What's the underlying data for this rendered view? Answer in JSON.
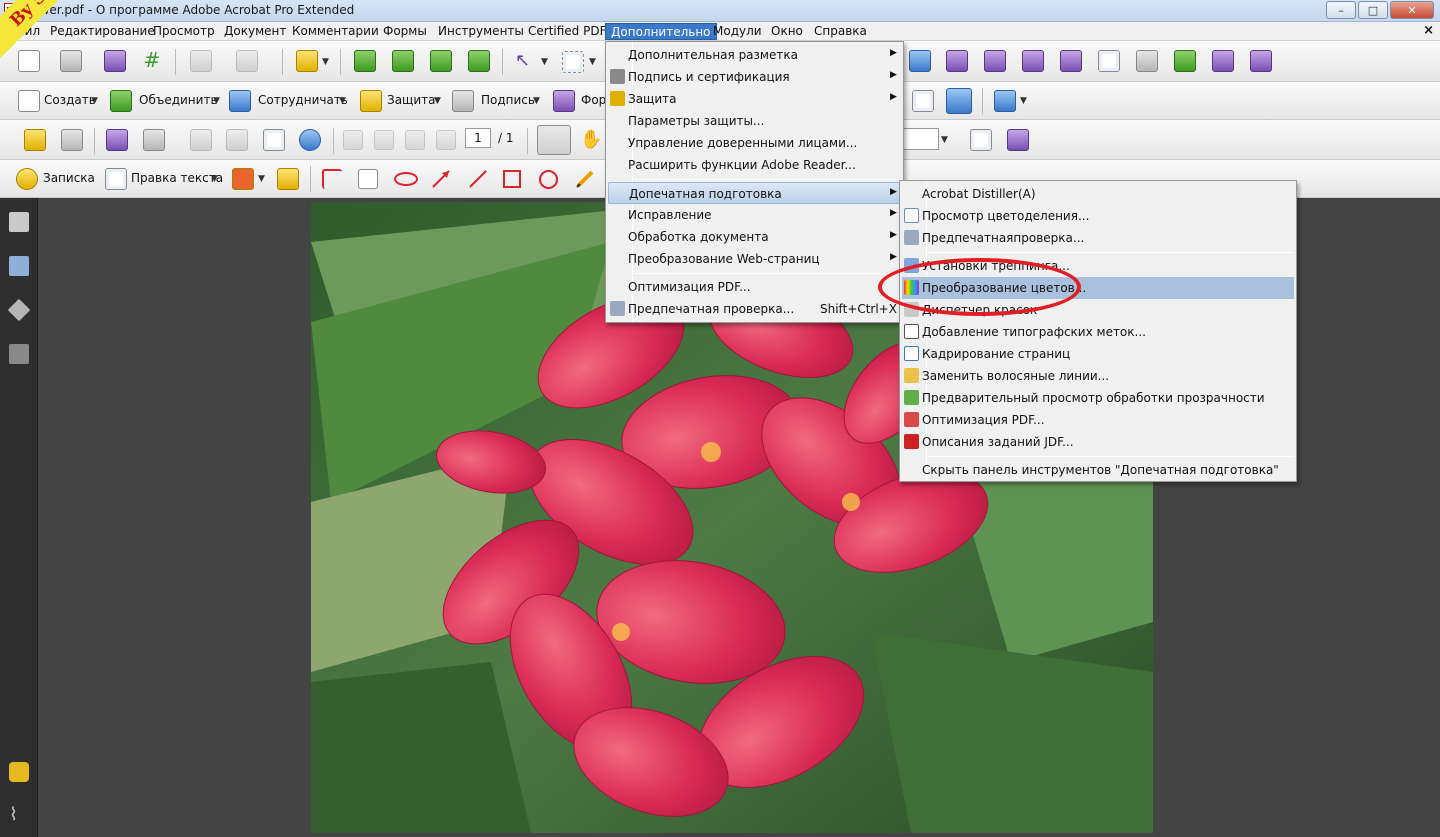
{
  "window": {
    "title": "Flower.pdf - О программе Adobe Acrobat Pro Extended",
    "buttons": {
      "minimize": "–",
      "maximize": "□",
      "close": "✕"
    }
  },
  "menubar": {
    "items": [
      "Файл",
      "Редактирование",
      "Просмотр",
      "Документ",
      "Комментарии",
      "Формы",
      "Инструменты",
      "Certified PDF",
      "Дополнительно",
      "Модули",
      "Окно",
      "Справка"
    ],
    "close_glyph": "×"
  },
  "watermark": "By Shadowbat",
  "toolbar2": {
    "create": "Создать",
    "combine": "Объединить",
    "collaborate": "Сотрудничать",
    "protect": "Защита",
    "sign": "Подпись",
    "forms": "Фор"
  },
  "toolbar3": {
    "page_number": "1",
    "page_total": "/ 1"
  },
  "toolbar4": {
    "note": "Записка",
    "edit_text": "Правка текста"
  },
  "main_menu": {
    "items": [
      {
        "label": "Дополнительная разметка",
        "submenu": true,
        "icon": ""
      },
      {
        "label": "Подпись и сертификация",
        "submenu": true,
        "icon": "pen-icon"
      },
      {
        "label": "Защита",
        "submenu": true,
        "icon": "lock-icon"
      },
      {
        "label": "Параметры защиты...",
        "submenu": false,
        "icon": ""
      },
      {
        "label": "Управление доверенными лицами...",
        "submenu": false,
        "icon": ""
      },
      {
        "label": "Расширить функции Adobe Reader...",
        "submenu": false,
        "icon": ""
      },
      {
        "label": "Допечатная подготовка",
        "submenu": true,
        "icon": ""
      },
      {
        "label": "Исправление",
        "submenu": true,
        "icon": ""
      },
      {
        "label": "Обработка документа",
        "submenu": true,
        "icon": ""
      },
      {
        "label": "Преобразование Web-страниц",
        "submenu": true,
        "icon": ""
      },
      {
        "label": "Оптимизация PDF...",
        "submenu": false,
        "icon": ""
      },
      {
        "label": "Предпечатная проверка...",
        "submenu": false,
        "icon": "preflight-icon",
        "shortcut": "Shift+Ctrl+X"
      }
    ]
  },
  "sub_menu": {
    "items": [
      {
        "label": "Acrobat Distiller(A)",
        "icon": ""
      },
      {
        "label": "Просмотр цветоделения...",
        "icon": "separations-icon"
      },
      {
        "label": "Предпечатнаяпроверка...",
        "icon": "preflight-icon"
      },
      {
        "label": "Установки треппинга...",
        "icon": "trap-icon"
      },
      {
        "label": "Преобразование цветов...",
        "icon": "color-convert-icon"
      },
      {
        "label": "Диспетчер красок",
        "icon": "ink-manager-icon"
      },
      {
        "label": "Добавление типографских меток...",
        "icon": "printer-marks-icon"
      },
      {
        "label": "Кадрирование страниц",
        "icon": "crop-icon"
      },
      {
        "label": "Заменить волосяные линии...",
        "icon": "hairline-icon"
      },
      {
        "label": "Предварительный просмотр обработки прозрачности",
        "icon": "flattener-icon"
      },
      {
        "label": "Оптимизация PDF...",
        "icon": "optimize-icon"
      },
      {
        "label": "Описания заданий JDF...",
        "icon": "jdf-icon"
      },
      {
        "label": "Скрыть панель инструментов \"Допечатная подготовка\"",
        "icon": ""
      }
    ]
  },
  "colors": {
    "menu_highlight": "#3a78c9",
    "annotation": "#e01f25",
    "watermark_bg": "#f4e73a",
    "watermark_text": "#cc1111"
  }
}
